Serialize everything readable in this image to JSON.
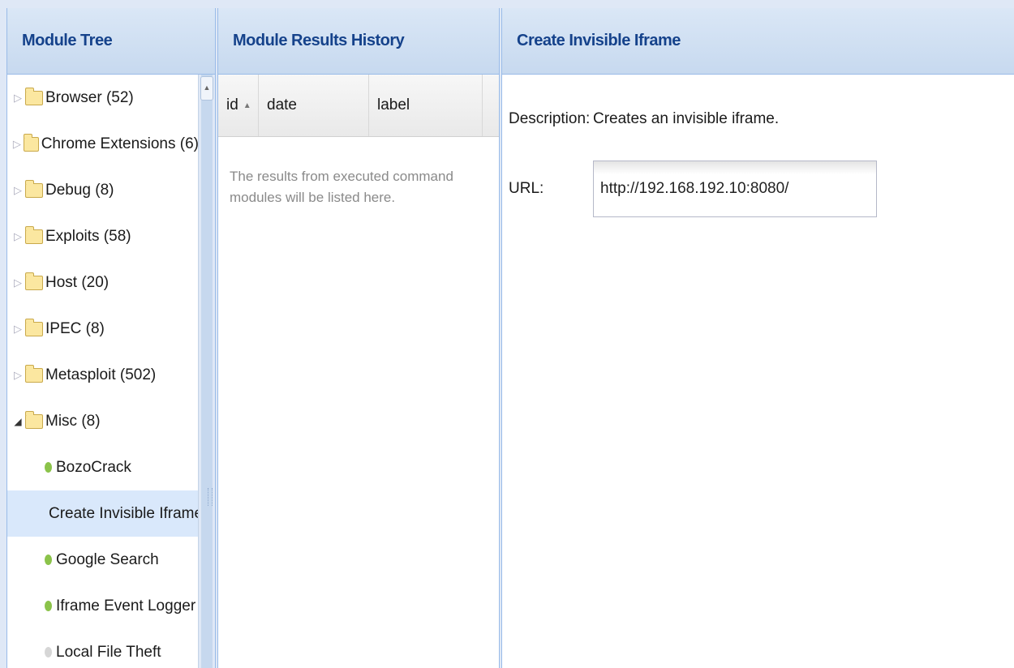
{
  "tree_panel": {
    "title": "Module Tree",
    "items": [
      {
        "label": "Browser (52)",
        "type": "folder",
        "expanded": false
      },
      {
        "label": "Chrome Extensions (6)",
        "type": "folder",
        "expanded": false
      },
      {
        "label": "Debug (8)",
        "type": "folder",
        "expanded": false
      },
      {
        "label": "Exploits (58)",
        "type": "folder",
        "expanded": false
      },
      {
        "label": "Host (20)",
        "type": "folder",
        "expanded": false
      },
      {
        "label": "IPEC (8)",
        "type": "folder",
        "expanded": false
      },
      {
        "label": "Metasploit (502)",
        "type": "folder",
        "expanded": false
      },
      {
        "label": "Misc (8)",
        "type": "folder",
        "expanded": true
      },
      {
        "label": "BozoCrack",
        "type": "module"
      },
      {
        "label": "Create Invisible Iframe",
        "type": "module",
        "selected": true
      },
      {
        "label": "Google Search",
        "type": "module"
      },
      {
        "label": "Iframe Event Logger",
        "type": "module"
      },
      {
        "label": "Local File Theft",
        "type": "module",
        "disabled": true
      }
    ]
  },
  "history_panel": {
    "title": "Module Results History",
    "columns": {
      "id": "id",
      "date": "date",
      "label": "label"
    },
    "empty_message": "The results from executed command modules will be listed here."
  },
  "detail_panel": {
    "title": "Create Invisible Iframe",
    "description_label": "Description:",
    "description_value": "Creates an invisible iframe.",
    "url_label": "URL:",
    "url_value": "http://192.168.192.10:8080/"
  },
  "colors": {
    "header_text": "#15428b",
    "header_bg": "#c7d9ef",
    "selection_bg": "#d9e8fb",
    "module_bullet": "#8bc34a"
  }
}
